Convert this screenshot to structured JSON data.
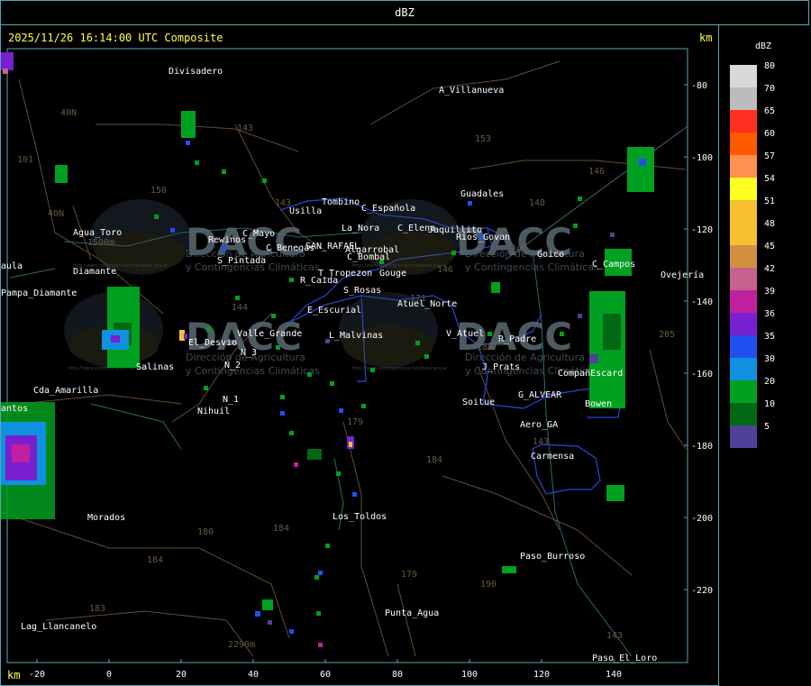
{
  "header": {
    "title": "dBZ"
  },
  "map": {
    "timestamp": "2025/11/26 16:14:00 UTC Composite",
    "unit_right": "km",
    "unit_bottom": "km",
    "y_ticks": [
      "-80",
      "-100",
      "-120",
      "-140",
      "-160",
      "-180",
      "-200",
      "-220"
    ],
    "x_ticks": [
      "-20",
      "0",
      "20",
      "40",
      "60",
      "80",
      "100",
      "120",
      "140"
    ],
    "places": [
      "Divisadero",
      "A_Villanueva",
      "Tombino",
      "Usilla",
      "C_Española",
      "Guadales",
      "La_Nora",
      "C_Elena",
      "Jaquillito",
      "Rios_Govan",
      "Goico",
      "Agua_Toro",
      "Rewinos",
      "C_Mayo",
      "SAN_RAFAEL",
      "C_Benegas",
      "Algarrobal",
      "C_Bombal",
      "S_Pintada",
      "T_Tropezon",
      "Gouge",
      "C_Campos",
      "Ovejería",
      "Pampa_Diamante",
      "R_Caida",
      "S_Rosas",
      "Atuel_Norte",
      "E_Escurial",
      "Valle_Grande",
      "L_Malvinas",
      "V_Atuel",
      "R_Padre",
      "El_Desvio",
      "N_3",
      "N_2",
      "J_Prats",
      "CompañEscard",
      "Salinas",
      "Cda_Amarilla",
      "G_ALVEAR",
      "Bowen",
      "N_1",
      "Nihuil",
      "Soitue",
      "Aero_GA",
      "Carmensa",
      "Morados",
      "Los_Toldos",
      "Paso_Burroso",
      "Punta_Agua",
      "Lag_Llancanelo",
      "Paso_El_Loro",
      "aula",
      "Diamante",
      "antos"
    ],
    "route_numbers": [
      "143",
      "153",
      "146",
      "148",
      "150",
      "143",
      "203",
      "40N",
      "101",
      "40N",
      "144",
      "171",
      "205",
      "188",
      "179",
      "184",
      "180",
      "184",
      "184",
      "183",
      "179",
      "190",
      "143",
      "143",
      "146"
    ],
    "elevations": [
      "1500m",
      "2290m"
    ],
    "watermark": {
      "logo": "DACC",
      "line1": "Dirección de Agricultura",
      "line2": "y Contingencias Climáticas",
      "url": "http://www.contingencias.mendoza.gov.ar"
    }
  },
  "legend": {
    "title": "dBZ",
    "items": [
      {
        "label": "80",
        "color": "#d8d8d8"
      },
      {
        "label": "70",
        "color": "#bcbcbc"
      },
      {
        "label": "65",
        "color": "#ff3020"
      },
      {
        "label": "60",
        "color": "#ff5a00"
      },
      {
        "label": "57",
        "color": "#ff9050"
      },
      {
        "label": "54",
        "color": "#ffff20"
      },
      {
        "label": "51",
        "color": "#f8c030"
      },
      {
        "label": "48",
        "color": "#f8c030"
      },
      {
        "label": "45",
        "color": "#d09040"
      },
      {
        "label": "42",
        "color": "#c86090"
      },
      {
        "label": "39",
        "color": "#c020a0"
      },
      {
        "label": "36",
        "color": "#7820d0"
      },
      {
        "label": "35",
        "color": "#2050f0"
      },
      {
        "label": "30",
        "color": "#1090e0"
      },
      {
        "label": "20",
        "color": "#00a020"
      },
      {
        "label": "10",
        "color": "#006814"
      },
      {
        "label": "5",
        "color": "#504098"
      }
    ]
  }
}
